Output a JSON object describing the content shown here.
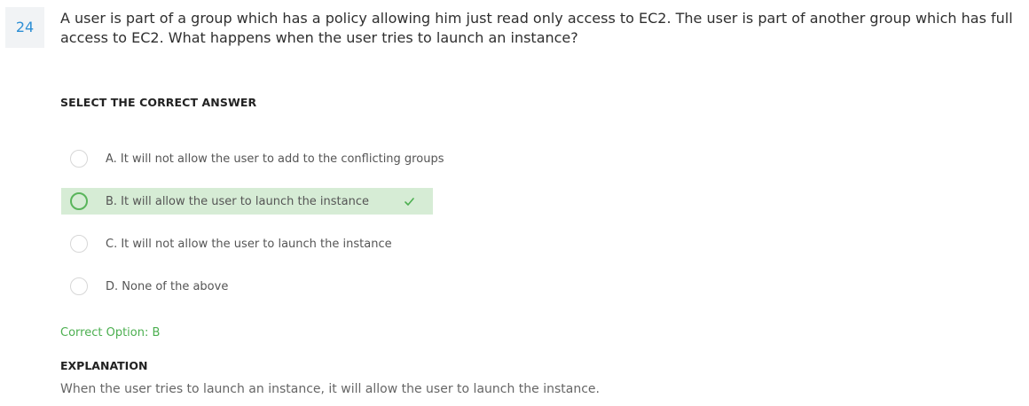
{
  "question": {
    "number": "24",
    "text": "A user is part of a group which has a policy allowing him just read only access to EC2. The user is part of another group which has full access to EC2. What happens when the user tries to launch an instance?"
  },
  "select_label": "SELECT THE CORRECT ANSWER",
  "options": [
    {
      "text": "A. It will not allow the user to add to the conflicting groups",
      "correct": false
    },
    {
      "text": "B. It will allow the user to launch the instance",
      "correct": true
    },
    {
      "text": "C. It will not allow the user to launch the instance",
      "correct": false
    },
    {
      "text": "D. None of the above",
      "correct": false
    }
  ],
  "correct_option": "Correct Option: B",
  "explanation": {
    "label": "EXPLANATION",
    "text": "When the user tries to launch an instance, it will allow the user to launch the instance."
  },
  "colors": {
    "accent_blue": "#2d8fd5",
    "correct_green": "#4caf50",
    "correct_bg": "#d6ecd5"
  }
}
